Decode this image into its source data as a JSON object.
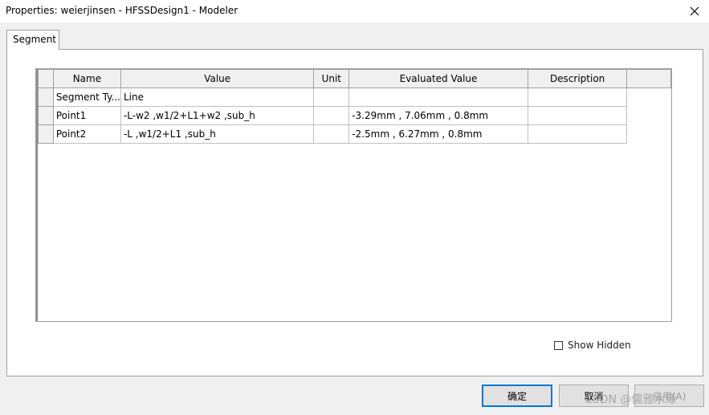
{
  "window": {
    "title": "Properties: weierjinsen - HFSSDesign1 - Modeler",
    "close_icon": "close-icon"
  },
  "tabs": [
    {
      "label": "Segment",
      "active": true
    }
  ],
  "table": {
    "columns": [
      "Name",
      "Value",
      "Unit",
      "Evaluated Value",
      "Description"
    ],
    "rows": [
      {
        "name": "Segment Ty...",
        "value": "Line",
        "unit": "",
        "evaluated": "",
        "description": ""
      },
      {
        "name": "Point1",
        "value": "-L-w2 ,w1/2+L1+w2 ,sub_h",
        "unit": "",
        "evaluated": "-3.29mm , 7.06mm , 0.8mm",
        "description": ""
      },
      {
        "name": "Point2",
        "value": "-L ,w1/2+L1 ,sub_h",
        "unit": "",
        "evaluated": "-2.5mm , 6.27mm , 0.8mm",
        "description": ""
      }
    ]
  },
  "options": {
    "show_hidden_label": "Show Hidden",
    "show_hidden_checked": false
  },
  "buttons": {
    "ok_label": "确定",
    "cancel_label": "取消",
    "extra_label": "应用(A)"
  },
  "watermark": "CSDN @儒雅水缘"
}
